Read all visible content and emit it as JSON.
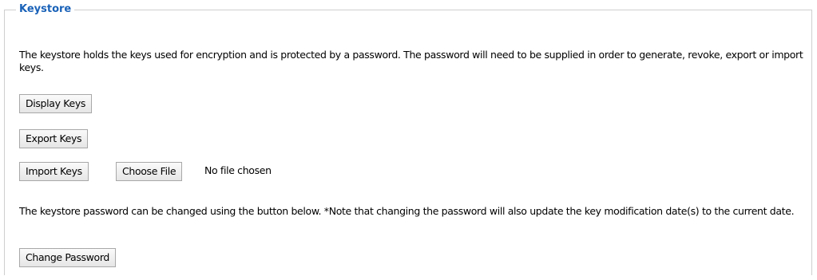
{
  "section": {
    "legend": "Keystore",
    "intro_text": "The keystore holds the keys used for encryption and is protected by a password. The password will need to be supplied in order to generate, revoke, export or import keys.",
    "buttons": {
      "display_keys": "Display Keys",
      "export_keys": "Export Keys",
      "import_keys": "Import Keys",
      "choose_file": "Choose File",
      "change_password": "Change Password"
    },
    "file_status": "No file chosen",
    "password_text": "The keystore password can be changed using the button below. *Note that changing the password will also update the key modification date(s) to the current date."
  },
  "colors": {
    "legend": "#1a62b8",
    "border": "#cfcfcf",
    "button_border": "#a8a8a8"
  }
}
